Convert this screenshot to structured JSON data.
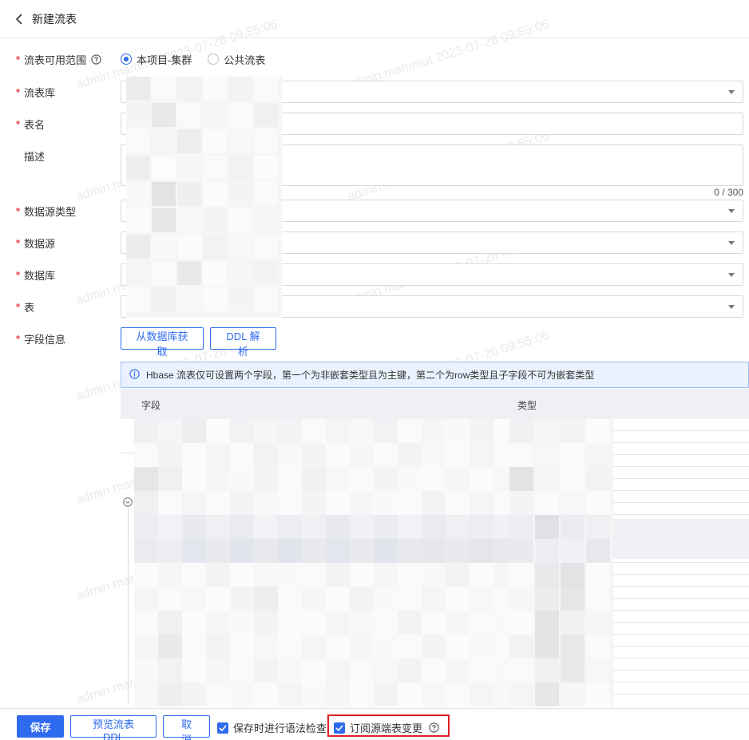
{
  "header": {
    "title": "新建流表"
  },
  "form": {
    "scope": {
      "label": "流表可用范围",
      "options": [
        "本项目-集群",
        "公共流表"
      ],
      "selected": "本项目-集群"
    },
    "stream_db": {
      "label": "流表库"
    },
    "table_name": {
      "label": "表名"
    },
    "description": {
      "label": "描述",
      "counter": "0 / 300"
    },
    "datasource_type": {
      "label": "数据源类型"
    },
    "datasource": {
      "label": "数据源"
    },
    "database": {
      "label": "数据库"
    },
    "table": {
      "label": "表"
    },
    "fields": {
      "label": "字段信息",
      "from_db_button": "从数据库获取",
      "ddl_button": "DDL 解析",
      "notice": "Hbase 流表仅可设置两个字段，第一个为非嵌套类型且为主键，第二个为row类型且子字段不可为嵌套类型",
      "columns": [
        "字段",
        "类型"
      ]
    }
  },
  "footer": {
    "save": "保存",
    "preview": "预览流表 DDL",
    "cancel": "取 消",
    "syntax_check": "保存时进行语法检查",
    "syntax_check_checked": true,
    "subscribe": "订阅源端表变更",
    "subscribe_checked": true
  },
  "watermark": "admin.mammut 2023-07-26 09:55:06",
  "colors": {
    "accent": "#2f6bef",
    "required": "#e84a4a",
    "highlight": "#e0202a"
  }
}
